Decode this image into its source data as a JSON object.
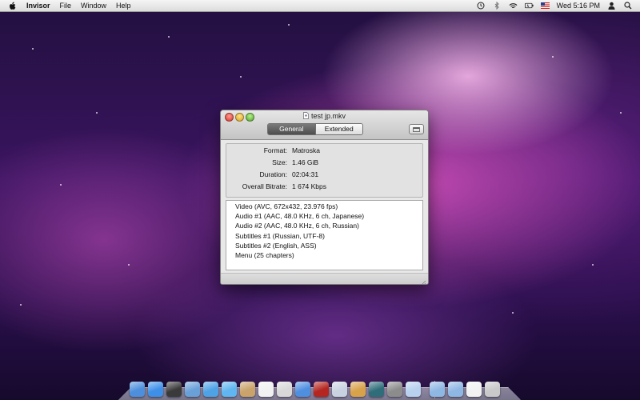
{
  "menubar": {
    "app_name": "Invisor",
    "items": [
      "File",
      "Window",
      "Help"
    ],
    "clock": "Wed 5:16 PM"
  },
  "window": {
    "title": "test jp.mkv",
    "tabs": [
      {
        "label": "General",
        "selected": true
      },
      {
        "label": "Extended",
        "selected": false
      }
    ],
    "info": [
      {
        "label": "Format:",
        "value": "Matroska"
      },
      {
        "label": "Size:",
        "value": "1.46 GiB"
      },
      {
        "label": "Duration:",
        "value": "02:04:31"
      },
      {
        "label": "Overall Bitrate:",
        "value": "1 674 Kbps"
      }
    ],
    "streams": [
      "Video (AVC, 672x432, 23.976 fps)",
      "Audio #1 (AAC, 48.0 KHz, 6 ch, Japanese)",
      "Audio #2 (AAC, 48.0 KHz, 6 ch, Russian)",
      "Subtitles #1 (Russian, UTF-8)",
      "Subtitles #2 (English, ASS)",
      "Menu (25 chapters)"
    ]
  },
  "dock": {
    "icons": [
      {
        "name": "finder-icon",
        "color": "#4d8fdc"
      },
      {
        "name": "app-store-icon",
        "color": "#3e8fe8"
      },
      {
        "name": "dashboard-icon",
        "color": "#3a3a3a"
      },
      {
        "name": "mail-icon",
        "color": "#6aa0d8"
      },
      {
        "name": "safari-icon",
        "color": "#4ea2e6"
      },
      {
        "name": "ichat-icon",
        "color": "#5fb6f0"
      },
      {
        "name": "address-book-icon",
        "color": "#c9a36a"
      },
      {
        "name": "ical-icon",
        "color": "#f1f1f1"
      },
      {
        "name": "preview-icon",
        "color": "#d8d8d8"
      },
      {
        "name": "itunes-icon",
        "color": "#4f8fe0"
      },
      {
        "name": "photo-booth-icon",
        "color": "#b4261f"
      },
      {
        "name": "iphoto-icon",
        "color": "#c9d2e0"
      },
      {
        "name": "garageband-icon",
        "color": "#d7a24a"
      },
      {
        "name": "time-machine-icon",
        "color": "#2f6d7a"
      },
      {
        "name": "system-preferences-icon",
        "color": "#8c8c8c"
      },
      {
        "name": "help-viewer-icon",
        "color": "#b8d1ee"
      },
      {
        "name": "applications-folder-icon",
        "color": "#8fb7e3"
      },
      {
        "name": "documents-folder-icon",
        "color": "#8fb7e3"
      },
      {
        "name": "document-stack-icon",
        "color": "#f2f2f2"
      },
      {
        "name": "trash-icon",
        "color": "#c9c9c9"
      }
    ]
  }
}
